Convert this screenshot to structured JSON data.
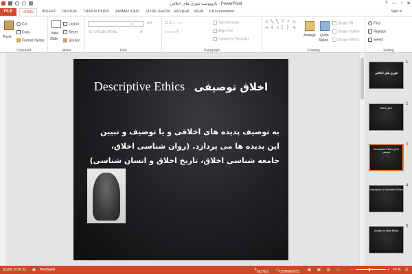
{
  "window": {
    "title": "بازوپوینت تئوری های اخلاقی - PowerPoint",
    "minimize": "—",
    "maximize": "▫",
    "close": "✕",
    "help": "?",
    "sign_in": "Sign in"
  },
  "tabs": [
    "FILE",
    "HOME",
    "INSERT",
    "DESIGN",
    "TRANSITIONS",
    "ANIMATIONS",
    "SLIDE SHOW",
    "REVIEW",
    "VIEW",
    "FILEminimizer"
  ],
  "ribbon": {
    "clipboard": {
      "label": "Clipboard",
      "paste": "Paste",
      "cut": "Cut",
      "copy": "Copy",
      "format_painter": "Format Painter"
    },
    "slides": {
      "label": "Slides",
      "new_slide": "New",
      "new_slide_2": "Slide",
      "layout": "Layout",
      "reset": "Reset",
      "section": "Section"
    },
    "font": {
      "label": "Font"
    },
    "paragraph": {
      "label": "Paragraph",
      "text_direction": "Text Direction",
      "align_text": "Align Text",
      "convert_smartart": "Convert to SmartArt"
    },
    "drawing": {
      "label": "Drawing",
      "arrange": "Arrange",
      "quick_styles": "Quick",
      "quick_styles_2": "Styles",
      "shape_fill": "Shape Fill",
      "shape_outline": "Shape Outline",
      "shape_effects": "Shape Effects"
    },
    "editing": {
      "label": "Editing",
      "find": "Find",
      "replace": "Replace",
      "select": "Select"
    }
  },
  "slide": {
    "title_fa": "اخلاق توصیفی",
    "title_en": "Descriptive Ethics",
    "body": "به توصیف پدیده های اخلاقی و یا توصیف و تبیین این پدیده ها می پردازد. (روان شناسی اخلاق، جامعه شناسی اخلاق، تاریخ اخلاق و انسان شناسی)"
  },
  "thumbnails": [
    {
      "num": "1",
      "text": "تئوری های اخلاقی"
    },
    {
      "num": "2",
      "text": "Moral   اخلاق"
    },
    {
      "num": "3",
      "text": "Descriptive Ethics  اخلاق توصیفی"
    },
    {
      "num": "4",
      "text": "Descriptive or Normative Ethics"
    },
    {
      "num": "5",
      "text": "Analytic or Meta Ethics"
    }
  ],
  "status": {
    "slide_of": "SLIDE 3 OF 22",
    "language": "PERSIAN",
    "notes": "NOTES",
    "comments": "COMMENTS",
    "zoom": "74 %",
    "zoom_fraction": 0.45
  },
  "colors": {
    "accent": "#d24726",
    "selected_thumb": "#e0793e"
  }
}
